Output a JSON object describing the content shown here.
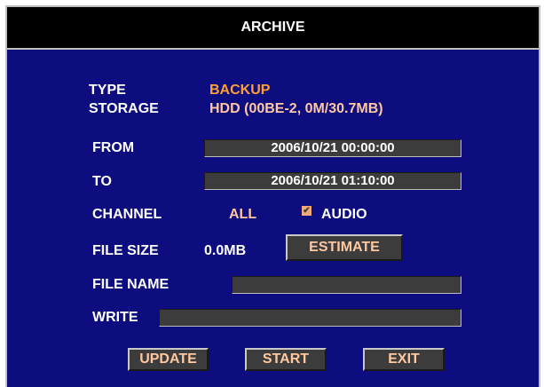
{
  "window": {
    "title": "ARCHIVE"
  },
  "info": {
    "type_label": "TYPE",
    "type_value": "BACKUP",
    "storage_label": "STORAGE",
    "storage_value": "HDD (00BE-2, 0M/30.7MB)"
  },
  "from": {
    "label": "FROM",
    "value": "2006/10/21  00:00:00"
  },
  "to": {
    "label": "TO",
    "value": "2006/10/21  01:10:00"
  },
  "channel": {
    "label": "CHANNEL",
    "value": "ALL",
    "audio_label": "AUDIO",
    "audio_checked": true
  },
  "file_size": {
    "label": "FILE  SIZE",
    "value": "0.0MB",
    "estimate_label": "ESTIMATE"
  },
  "file_name": {
    "label": "FILE NAME",
    "value": ""
  },
  "write": {
    "label": "WRITE",
    "value": ""
  },
  "buttons": {
    "update": "UPDATE",
    "start": "START",
    "exit": "EXIT"
  },
  "colors": {
    "panel_bg": "#0d0d7f",
    "title_bg": "#000000",
    "accent_orange": "#ff9f33",
    "accent_peach": "#ffc8a0",
    "field_bg": "#3c3c3c"
  }
}
